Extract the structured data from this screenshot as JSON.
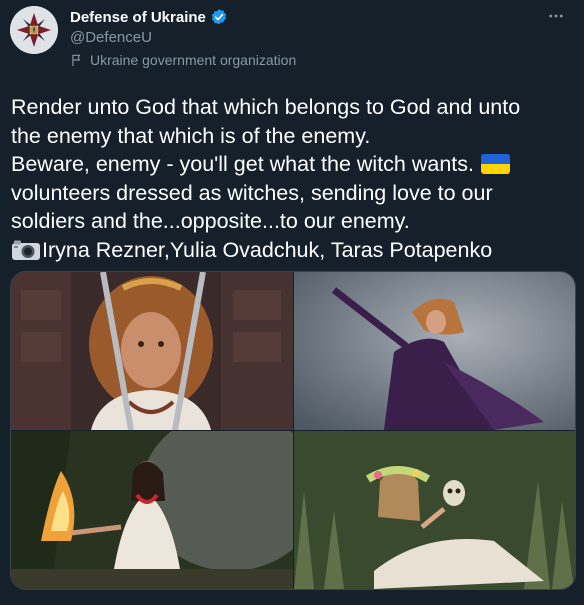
{
  "account": {
    "display_name": "Defense of Ukraine",
    "handle": "@DefenceU",
    "label": "Ukraine government organization"
  },
  "tweet": {
    "lines": [
      "Render unto God that which belongs to God and unto",
      "the enemy that which is of the enemy.",
      "Beware, enemy - you'll get what the witch wants.",
      "volunteers dressed as witches, sending love to our",
      "soldiers and the...opposite...to our enemy.",
      "Iryna Rezner,Yulia Ovadchuk, Taras Potapenko"
    ]
  },
  "icons": {
    "verified": "verified-badge-icon",
    "label": "flag-icon",
    "more": "more-dots-icon",
    "ukraine_flag": "ukraine-flag-emoji",
    "camera": "camera-emoji"
  },
  "colors": {
    "background": "#15202b",
    "secondary_text": "#8899a6",
    "verified_blue": "#1d9bf0",
    "ukraine_blue": "#1f64d6",
    "ukraine_yellow": "#ffd400",
    "border": "#38444d"
  }
}
